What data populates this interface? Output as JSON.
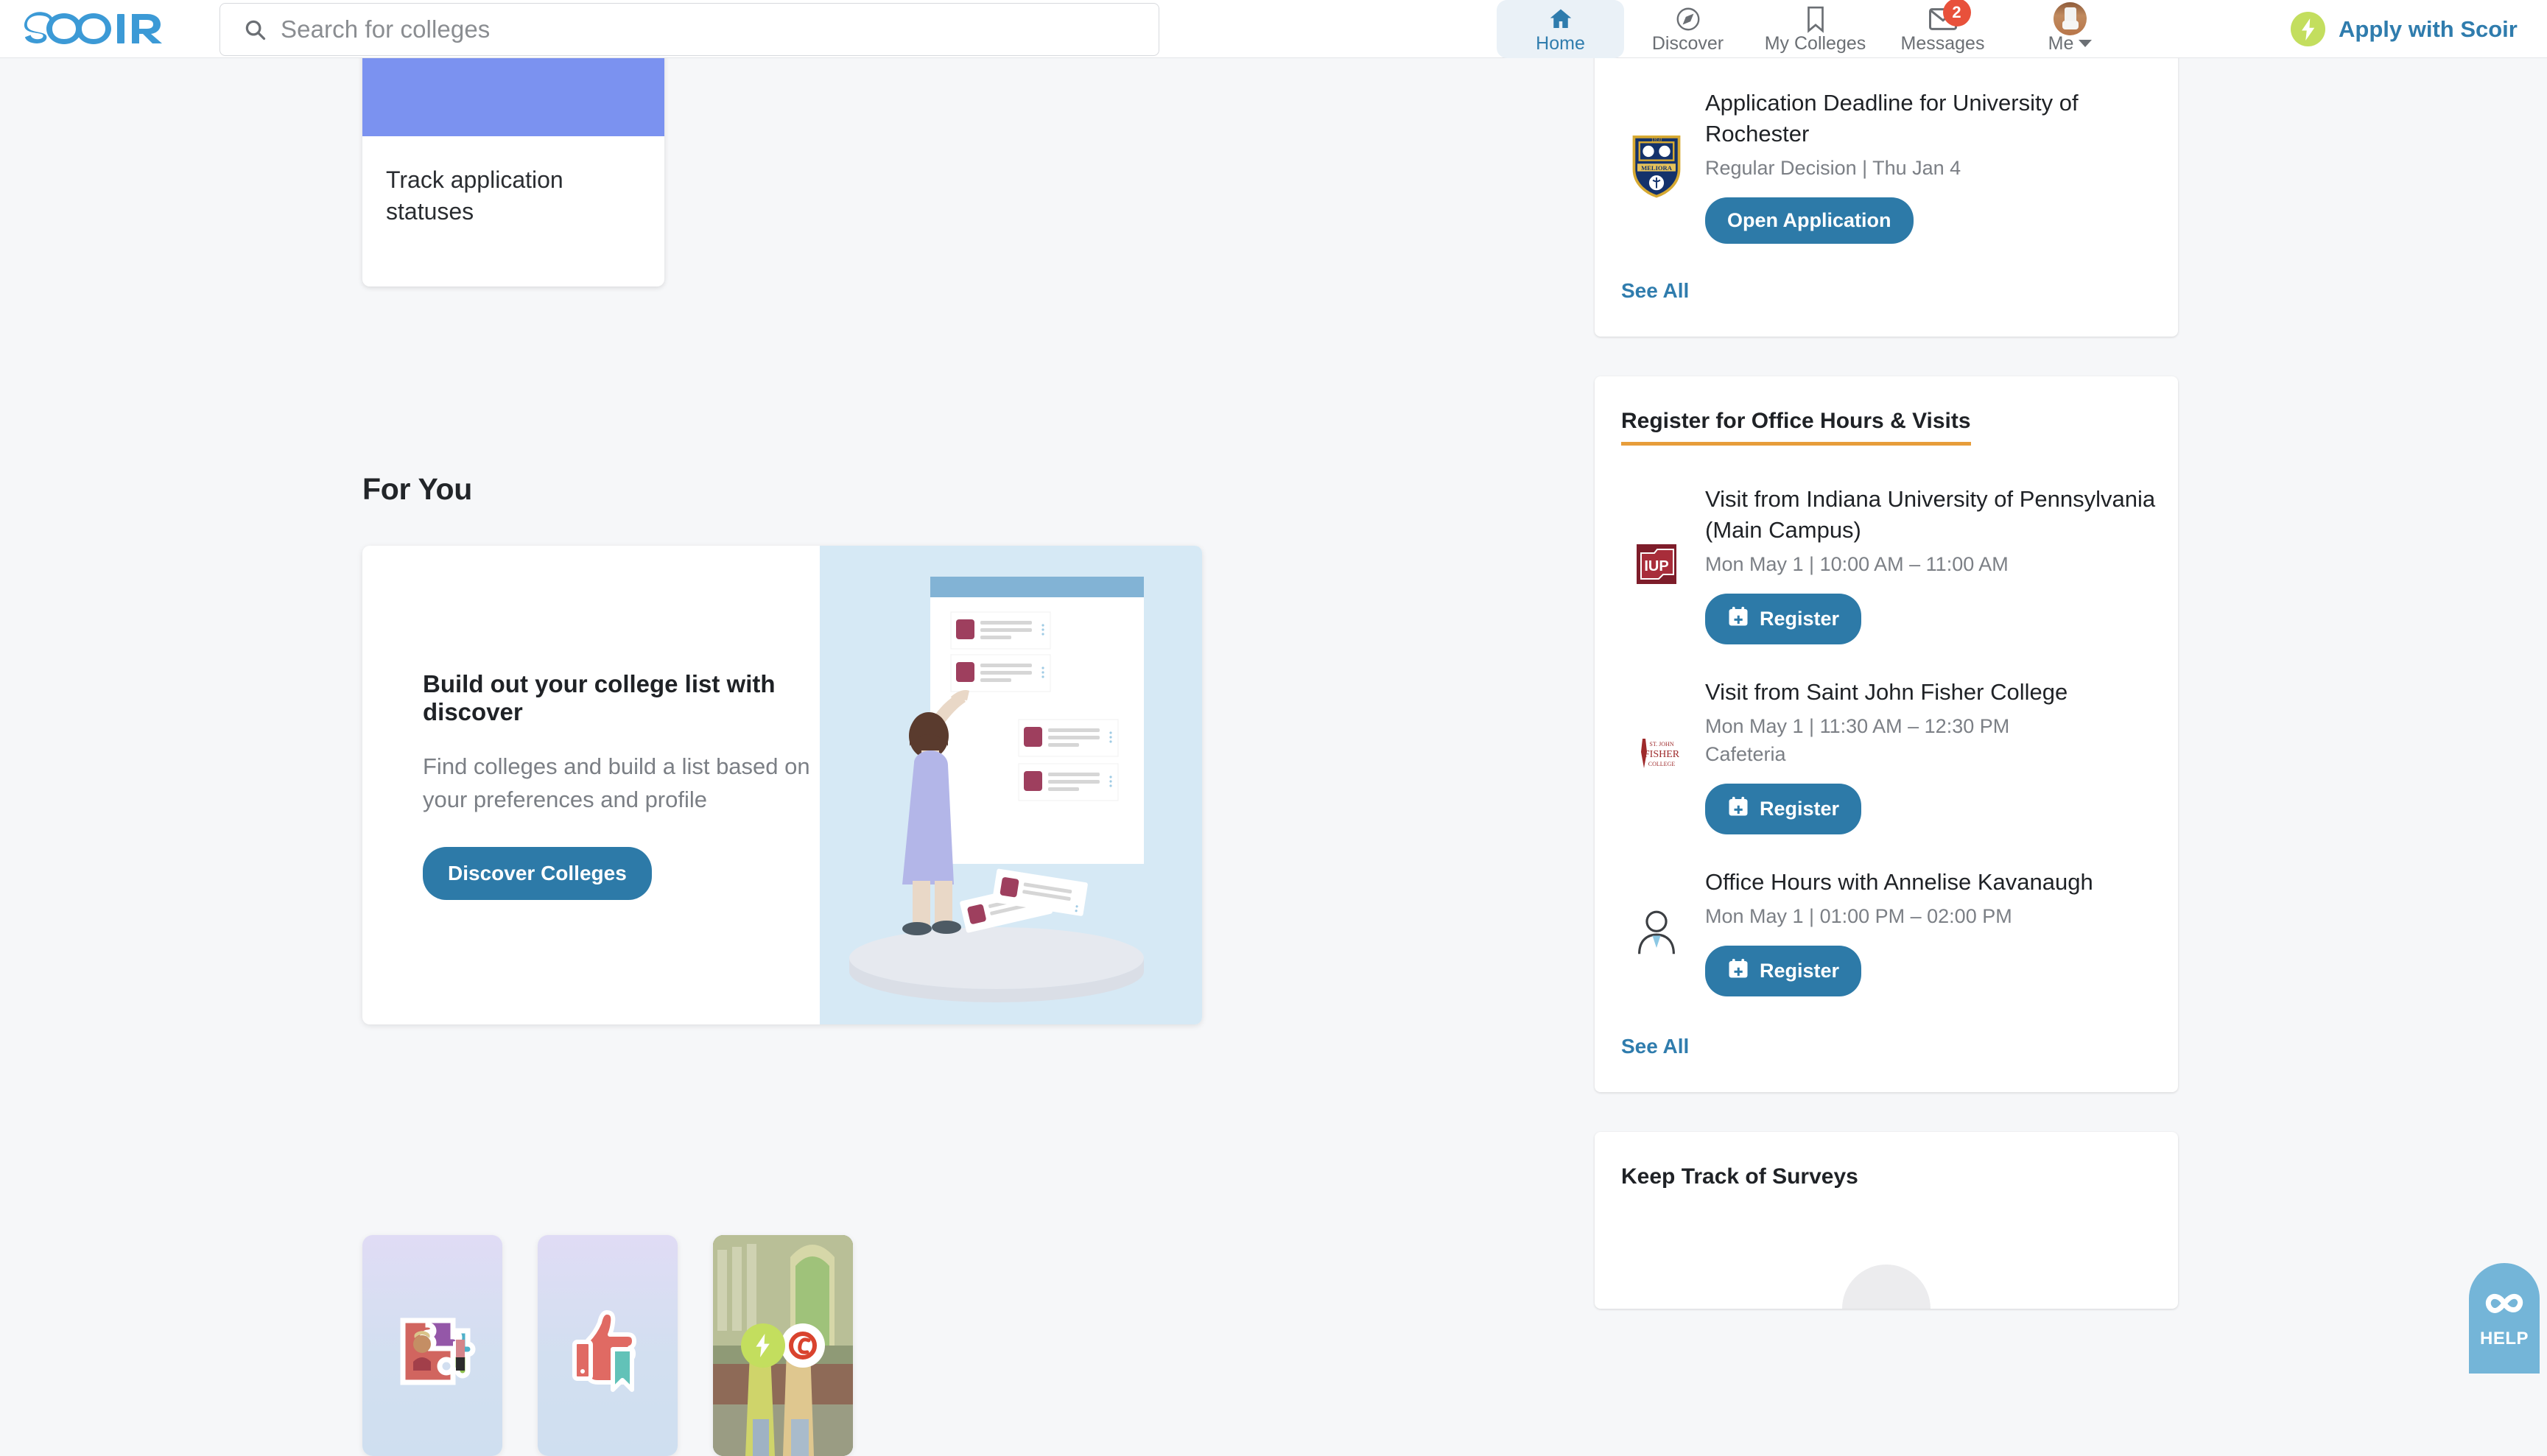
{
  "header": {
    "logo_text": "SCOIR",
    "search": {
      "placeholder": "Search for colleges",
      "value": ""
    },
    "nav": [
      {
        "label": "Home",
        "icon": "home-icon",
        "active": true,
        "badge": ""
      },
      {
        "label": "Discover",
        "icon": "compass-icon",
        "active": false,
        "badge": ""
      },
      {
        "label": "My Colleges",
        "icon": "bookmark-icon",
        "active": false,
        "badge": ""
      },
      {
        "label": "Messages",
        "icon": "envelope-icon",
        "active": false,
        "badge": "2"
      },
      {
        "label": "Me",
        "icon": "avatar-icon",
        "active": false,
        "badge": ""
      }
    ],
    "apply_cta": "Apply with Scoir"
  },
  "main": {
    "track_card": {
      "title": "Track application statuses",
      "icon": "checklist-icon",
      "banner_color": "#7b92f0"
    },
    "for_you": {
      "section_title": "For You",
      "heading": "Build out your college list with discover",
      "subtext": "Find colleges and build a list based on your preferences and profile",
      "button": "Discover Colleges",
      "illustration": "woman-organizing-college-list-illustration"
    },
    "bottom_cards": [
      {
        "icon": "puzzle-pieces-icon",
        "style": "gradient"
      },
      {
        "icon": "thumbs-up-bookmark-icon",
        "style": "gradient"
      },
      {
        "icon": "scoir-apply-photo",
        "style": "photo"
      }
    ]
  },
  "sidebar": {
    "deadlines": {
      "items": [
        {
          "logo": "university-of-rochester-crest",
          "title": "Application Deadline for University of Rochester",
          "meta": "Regular Decision | Thu Jan 4",
          "button": "Open Application"
        }
      ],
      "see_all": "See All"
    },
    "office_hours": {
      "title": "Register for Office Hours & Visits",
      "accent_color": "#e79d3a",
      "items": [
        {
          "logo": "iup-logo",
          "title": "Visit from Indiana University of Pennsylvania (Main Campus)",
          "meta": "Mon May 1 | 10:00 AM – 11:00 AM",
          "location": "",
          "button": "Register"
        },
        {
          "logo": "saint-john-fisher-logo",
          "title": "Visit from Saint John Fisher College",
          "meta": "Mon May 1 | 11:30 AM – 12:30 PM",
          "location": "Cafeteria",
          "button": "Register"
        },
        {
          "logo": "person-icon",
          "title": "Office Hours with Annelise Kavanaugh",
          "meta": "Mon May 1 | 01:00 PM – 02:00 PM",
          "location": "",
          "button": "Register"
        }
      ],
      "see_all": "See All"
    },
    "surveys": {
      "title": "Keep Track of Surveys"
    }
  },
  "help": {
    "label": "HELP",
    "icon": "infinity-icon",
    "color": "#74b5d8"
  }
}
